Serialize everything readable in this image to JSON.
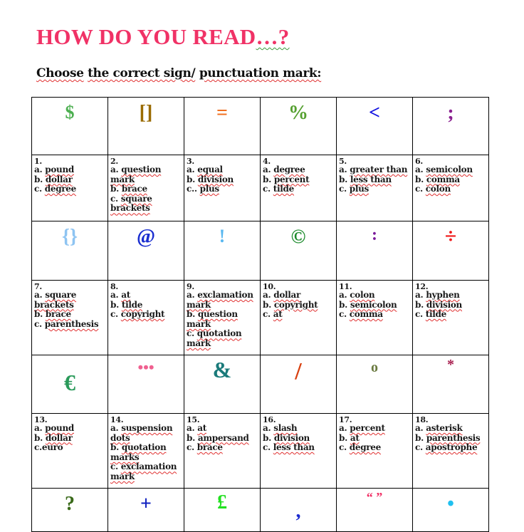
{
  "heading": {
    "title": "HOW DO YOU READ",
    "title_suffix": "…?"
  },
  "instruction": {
    "word1": "Choose",
    "word2": "the correct sign/",
    "word3": "punctuation mark:"
  },
  "rows": [
    {
      "symbols": [
        {
          "glyph": "$",
          "color": "#4caf50"
        },
        {
          "glyph": "[]",
          "color": "#9a6b00"
        },
        {
          "glyph": "=",
          "color": "#f07020"
        },
        {
          "glyph": "%",
          "color": "#55a030"
        },
        {
          "glyph": "<",
          "color": "#1010e0"
        },
        {
          "glyph": ";",
          "color": "#8a2090"
        }
      ],
      "questions": [
        {
          "number": "1.",
          "options": [
            "a. pound",
            "b. dollar",
            "c. degree"
          ]
        },
        {
          "number": "2.",
          "options": [
            "a. question mark",
            "b. brace",
            "c. square brackets"
          ]
        },
        {
          "number": "3.",
          "options": [
            "a. equal",
            "b. division",
            "c.. plus"
          ]
        },
        {
          "number": "4.",
          "options": [
            "a. degree",
            "b. percent",
            "c. tilde"
          ]
        },
        {
          "number": "5.",
          "options": [
            "a. greater than",
            "b. less than",
            "c. plus"
          ]
        },
        {
          "number": "6.",
          "options": [
            "a. semicolon",
            "b. comma",
            "c. colon"
          ]
        }
      ]
    },
    {
      "symbols": [
        {
          "glyph": "{}",
          "color": "#8ec4f2"
        },
        {
          "glyph": "@",
          "color": "#1a2ed0"
        },
        {
          "glyph": "!",
          "color": "#5ab8f0"
        },
        {
          "glyph": "©",
          "color": "#1a8a2a"
        },
        {
          "glyph": ":",
          "color": "#7a1a9a"
        },
        {
          "glyph": "÷",
          "color": "#f01818"
        }
      ],
      "questions": [
        {
          "number": "7.",
          "options": [
            "a. square brackets",
            "b. brace",
            "c. parenthesis"
          ]
        },
        {
          "number": "8.",
          "options": [
            "a. at",
            "b. tilde",
            "c. copyright"
          ]
        },
        {
          "number": "9.",
          "options": [
            "a. exclamation mark",
            "b. question mark",
            "c.  quotation mark"
          ]
        },
        {
          "number": "10.",
          "options": [
            "a. dollar",
            "b. copyright",
            "c.  at"
          ]
        },
        {
          "number": "11.",
          "options": [
            "a. colon",
            "b. semicolon",
            "c. comma"
          ]
        },
        {
          "number": "12.",
          "options": [
            "a. hyphen",
            "b. division",
            "c. tilde"
          ]
        }
      ]
    },
    {
      "symbols": [
        {
          "glyph": "€",
          "color": "#2a9a5a"
        },
        {
          "glyph": "•••",
          "color": "#f06090"
        },
        {
          "glyph": "&",
          "color": "#1a7a7a"
        },
        {
          "glyph": "/",
          "color": "#d84010"
        },
        {
          "glyph": "o",
          "color": "#6a7a40"
        },
        {
          "glyph": "*",
          "color": "#a82050"
        }
      ],
      "questions": [
        {
          "number": "13.",
          "options": [
            "a. pound",
            "b. dollar",
            "c.euro"
          ]
        },
        {
          "number": "14.",
          "options": [
            "a. suspension dots",
            "b. quotation marks",
            "c. exclamation mark"
          ]
        },
        {
          "number": "15.",
          "options": [
            "a. at",
            "b. ampersand",
            "c. brace"
          ]
        },
        {
          "number": "16.",
          "options": [
            "a. slash",
            "b.  division",
            "c. less than"
          ]
        },
        {
          "number": "17.",
          "options": [
            "a. percent",
            "b. at",
            "c. degree"
          ]
        },
        {
          "number": "18.",
          "options": [
            "a. asterisk",
            "b. parenthesis",
            "c. apostrophe"
          ]
        }
      ]
    },
    {
      "symbols": [
        {
          "glyph": "?",
          "color": "#3a6a1a"
        },
        {
          "glyph": "+",
          "color": "#1020c0"
        },
        {
          "glyph": "£",
          "color": "#22e020"
        },
        {
          "glyph": ",",
          "color": "#1a2ad0"
        },
        {
          "glyph": "“  ”",
          "color": "#f02860"
        },
        {
          "glyph": "•",
          "color": "#20c0f0"
        }
      ]
    }
  ]
}
